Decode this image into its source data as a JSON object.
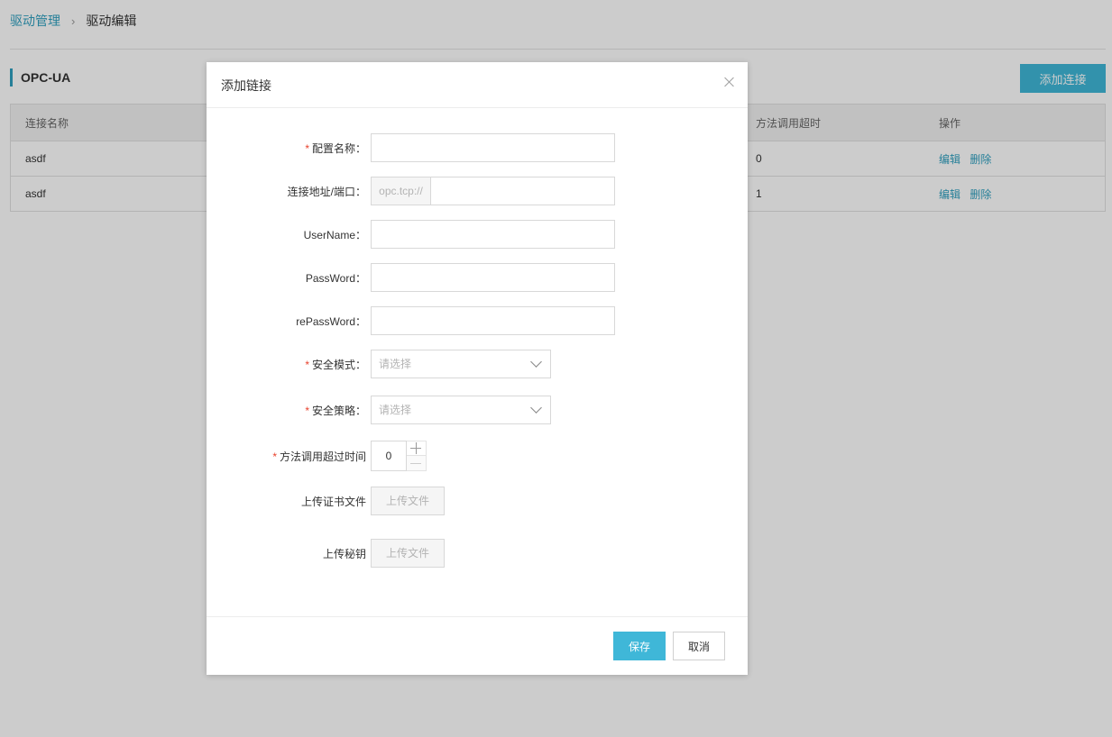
{
  "breadcrumb": {
    "parent": "驱动管理",
    "separator": "›",
    "current": "驱动编辑"
  },
  "section": {
    "title": "OPC-UA",
    "add_button": "添加连接"
  },
  "table": {
    "headers": [
      "连接名称",
      "方法调用超时",
      "操作"
    ],
    "rows": [
      {
        "name": "asdf",
        "timeout": "0",
        "edit": "编辑",
        "delete": "删除"
      },
      {
        "name": "asdf",
        "timeout": "1",
        "edit": "编辑",
        "delete": "删除"
      }
    ]
  },
  "modal": {
    "title": "添加链接",
    "fields": {
      "config_name": {
        "label": "配置名称：",
        "required": "*",
        "value": ""
      },
      "address": {
        "label": "连接地址/端口：",
        "prefix": "opc.tcp://",
        "value": ""
      },
      "username": {
        "label": "UserName：",
        "value": ""
      },
      "password": {
        "label": "PassWord：",
        "value": ""
      },
      "repassword": {
        "label": "rePassWord：",
        "value": ""
      },
      "security_mode": {
        "label": "安全模式：",
        "required": "*",
        "placeholder": "请选择"
      },
      "security_policy": {
        "label": "安全策略：",
        "required": "*",
        "placeholder": "请选择"
      },
      "timeout": {
        "label": "方法调用超过时间",
        "required": "*",
        "value": "0"
      },
      "cert_upload": {
        "label": "上传证书文件",
        "button": "上传文件"
      },
      "key_upload": {
        "label": "上传秘钥",
        "button": "上传文件"
      }
    },
    "footer": {
      "save": "保存",
      "cancel": "取消"
    }
  },
  "colors": {
    "accent": "#3fb7d8",
    "link": "#2f9fbf",
    "required": "#e8412c"
  }
}
